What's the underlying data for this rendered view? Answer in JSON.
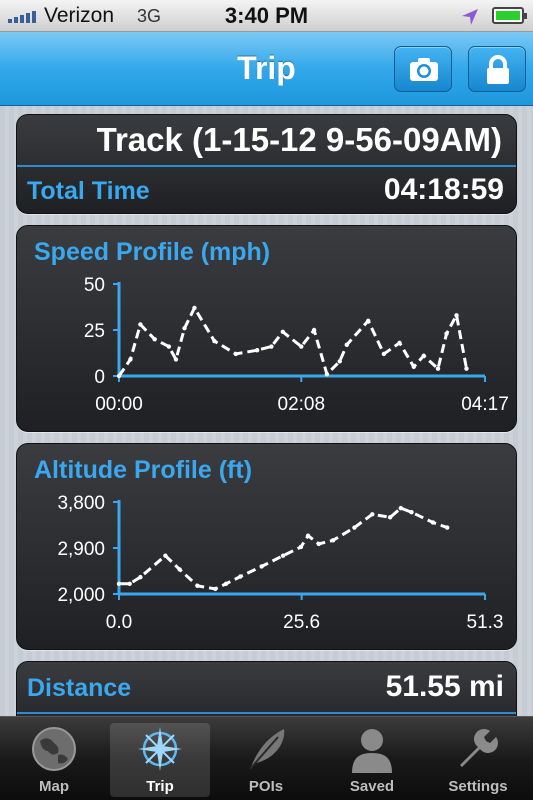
{
  "status_bar": {
    "carrier": "Verizon",
    "network": "3G",
    "time": "3:40 PM",
    "icons": [
      "signal-icon",
      "location-arrow-icon",
      "battery-icon"
    ]
  },
  "nav": {
    "title": "Trip",
    "buttons": [
      "camera-icon",
      "lock-icon"
    ]
  },
  "track": {
    "name": "Track (1-15-12 9-56-09AM)",
    "total_time_label": "Total Time",
    "total_time_value": "04:18:59"
  },
  "distance": {
    "label": "Distance",
    "value": "51.55 mi"
  },
  "chart_data": [
    {
      "type": "line",
      "title": "Speed Profile (mph)",
      "x_tick_labels": [
        "00:00",
        "02:08",
        "04:17"
      ],
      "y_tick_labels": [
        "50",
        "25",
        "0"
      ],
      "x_range_minutes": [
        0,
        257
      ],
      "ylim": [
        0,
        50
      ],
      "y_ticks": [
        0,
        25,
        50
      ],
      "x_ticks": [
        0,
        128,
        257
      ],
      "series": [
        {
          "x": [
            0,
            8,
            15,
            25,
            35,
            40,
            46,
            53,
            67,
            82,
            97,
            107,
            115,
            128,
            137,
            146,
            155,
            160,
            175,
            186,
            197,
            207,
            214,
            224,
            230,
            237,
            244
          ],
          "y": [
            0,
            9,
            28,
            20,
            16,
            9,
            26,
            37,
            19,
            12,
            14,
            16,
            24,
            16,
            25,
            1,
            8,
            17,
            30,
            12,
            18,
            5,
            11,
            4,
            23,
            33,
            4
          ]
        }
      ],
      "grid": false
    },
    {
      "type": "line",
      "title": "Altitude Profile (ft)",
      "x_tick_labels": [
        "0.0",
        "25.6",
        "51.3"
      ],
      "y_tick_labels": [
        "3,800",
        "2,900",
        "2,000"
      ],
      "xlim": [
        0,
        51.3
      ],
      "ylim": [
        2000,
        3800
      ],
      "y_ticks": [
        2000,
        2900,
        3800
      ],
      "x_ticks": [
        0,
        25.6,
        51.3
      ],
      "series": [
        {
          "x": [
            0,
            1.5,
            3,
            6.5,
            8.5,
            11,
            13.5,
            15,
            17,
            20,
            23,
            25.5,
            26.5,
            28,
            30,
            33,
            35.5,
            38,
            39.5,
            41,
            44,
            46
          ],
          "y": [
            2200,
            2200,
            2330,
            2750,
            2480,
            2160,
            2100,
            2200,
            2340,
            2540,
            2750,
            2920,
            3140,
            2980,
            3050,
            3300,
            3560,
            3500,
            3680,
            3600,
            3400,
            3300
          ]
        }
      ],
      "grid": false
    }
  ],
  "tabs": [
    {
      "label": "Map",
      "icon": "globe-icon",
      "active": false
    },
    {
      "label": "Trip",
      "icon": "compass-icon",
      "active": true
    },
    {
      "label": "POIs",
      "icon": "feather-icon",
      "active": false
    },
    {
      "label": "Saved",
      "icon": "person-icon",
      "active": false
    },
    {
      "label": "Settings",
      "icon": "wrench-icon",
      "active": false
    }
  ],
  "colors": {
    "accent_blue": "#3aa7ee",
    "navbar_blue": "#1e97de",
    "panel_dark": "#2b2d31",
    "chart_axis": "#3aa7ee",
    "chart_line": "#ffffff",
    "battery_green": "#2bd12b"
  }
}
